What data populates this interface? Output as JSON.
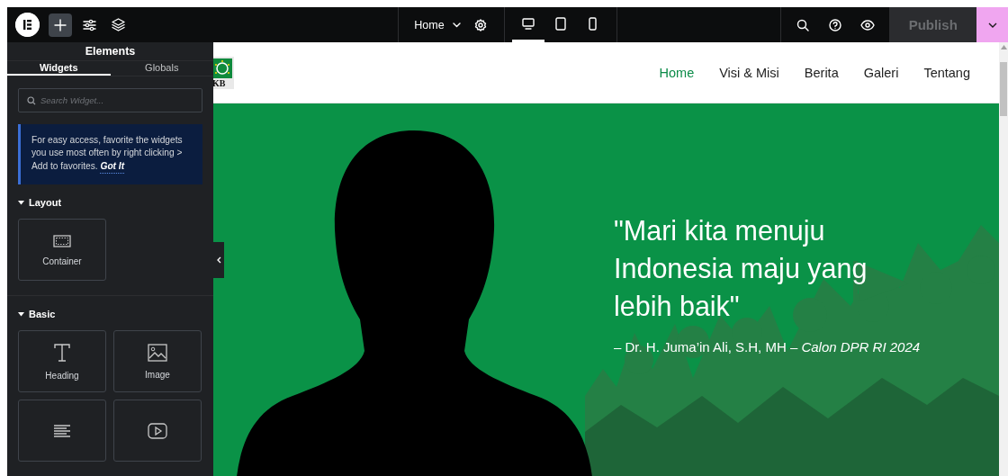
{
  "topbar": {
    "tools": [
      {
        "kind": "add",
        "selected": true
      },
      {
        "kind": "settings",
        "selected": false
      },
      {
        "kind": "structure",
        "selected": false
      }
    ],
    "page_selector": "Home",
    "devices": [
      {
        "kind": "desktop",
        "selected": true
      },
      {
        "kind": "tablet",
        "selected": false
      },
      {
        "kind": "mobile",
        "selected": false
      }
    ],
    "publish": {
      "label": "Publish",
      "disabled": true
    }
  },
  "panel": {
    "title": "Elements",
    "tabs": [
      {
        "label": "Widgets",
        "selected": true
      },
      {
        "label": "Globals",
        "selected": false
      }
    ],
    "search": {
      "placeholder": "Search Widget..."
    },
    "tip": {
      "text": "For easy access, favorite the widgets you use most often by right clicking > Add to favorites.",
      "link": "Got It"
    },
    "categories": [
      {
        "name": "Layout",
        "expanded": true,
        "widgets": [
          {
            "kind": "container",
            "label": "Container"
          }
        ]
      },
      {
        "name": "Basic",
        "expanded": true,
        "widgets": [
          {
            "kind": "heading",
            "label": "Heading"
          },
          {
            "kind": "image",
            "label": "Image"
          },
          {
            "kind": "text-editor"
          },
          {
            "kind": "video"
          }
        ]
      }
    ]
  },
  "site": {
    "logo_text": "KB",
    "nav": [
      {
        "label": "Home",
        "selected": true
      },
      {
        "label": "Visi & Misi",
        "selected": false
      },
      {
        "label": "Berita",
        "selected": false
      },
      {
        "label": "Galeri",
        "selected": false
      },
      {
        "label": "Tentang",
        "selected": false
      }
    ],
    "hero": {
      "quote": "\"Mari kita menuju Indonesia maju yang lebih baik\"",
      "attribution": "– Dr. H. Juma’in Ali, S.H, MH – *Calon DPR RI 2024*"
    }
  }
}
